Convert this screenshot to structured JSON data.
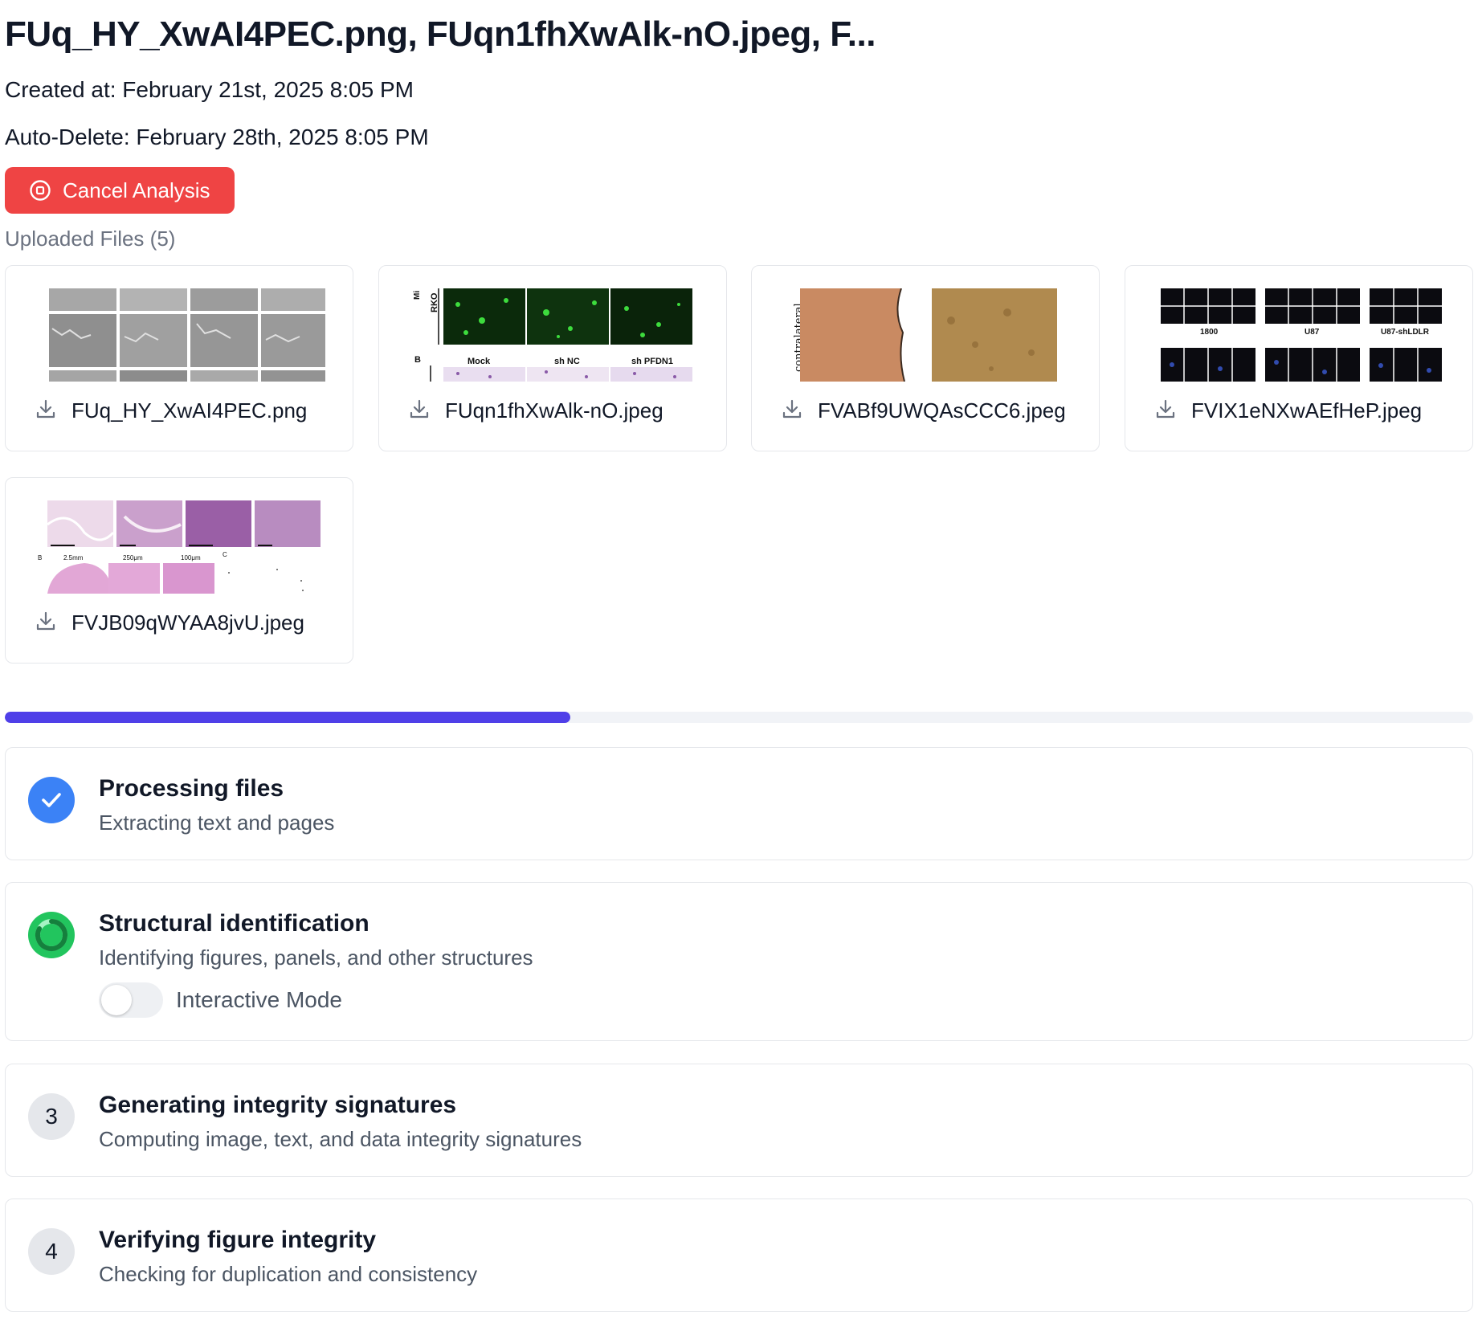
{
  "header": {
    "title": "FUq_HY_XwAI4PEC.png, FUqn1fhXwAlk-nO.jpeg, F...",
    "created_at": "Created at: February 21st, 2025 8:05 PM",
    "auto_delete": "Auto-Delete: February 28th, 2025 8:05 PM",
    "cancel_label": "Cancel Analysis"
  },
  "uploads": {
    "label": "Uploaded Files (5)",
    "files": [
      {
        "name": "FUq_HY_XwAI4PEC.png"
      },
      {
        "name": "FUqn1fhXwAlk-nO.jpeg",
        "thumb_text": {
          "mi": "Mi",
          "rko": "RKO",
          "b": "B",
          "mock": "Mock",
          "shnc": "sh NC",
          "shpf": "sh PFDN1"
        }
      },
      {
        "name": "FVABf9UWQAsCCC6.jpeg",
        "thumb_text": {
          "side": "contralateral"
        }
      },
      {
        "name": "FVIX1eNXwAEfHeP.jpeg",
        "thumb_text": {
          "a": "1800",
          "b": "U87",
          "c": "U87-shLDLR"
        }
      },
      {
        "name": "FVJB09qWYAA8jvU.jpeg",
        "thumb_text": {
          "s1": "2.5mm",
          "s2": "250μm",
          "s3": "100μm",
          "b": "B",
          "c": "C"
        }
      }
    ]
  },
  "progress": {
    "percent": 38.5
  },
  "steps": [
    {
      "title": "Processing files",
      "description": "Extracting text and pages",
      "status": "done"
    },
    {
      "title": "Structural identification",
      "description": "Identifying figures, panels, and other structures",
      "status": "active",
      "toggle_label": "Interactive Mode",
      "toggle_on": false
    },
    {
      "number": "3",
      "title": "Generating integrity signatures",
      "description": "Computing image, text, and data integrity signatures",
      "status": "pending"
    },
    {
      "number": "4",
      "title": "Verifying figure integrity",
      "description": "Checking for duplication and consistency",
      "status": "pending"
    }
  ],
  "colors": {
    "danger": "#ef4444",
    "progress": "#4f3fe8",
    "done": "#3b82f6",
    "active": "#22c55e"
  }
}
